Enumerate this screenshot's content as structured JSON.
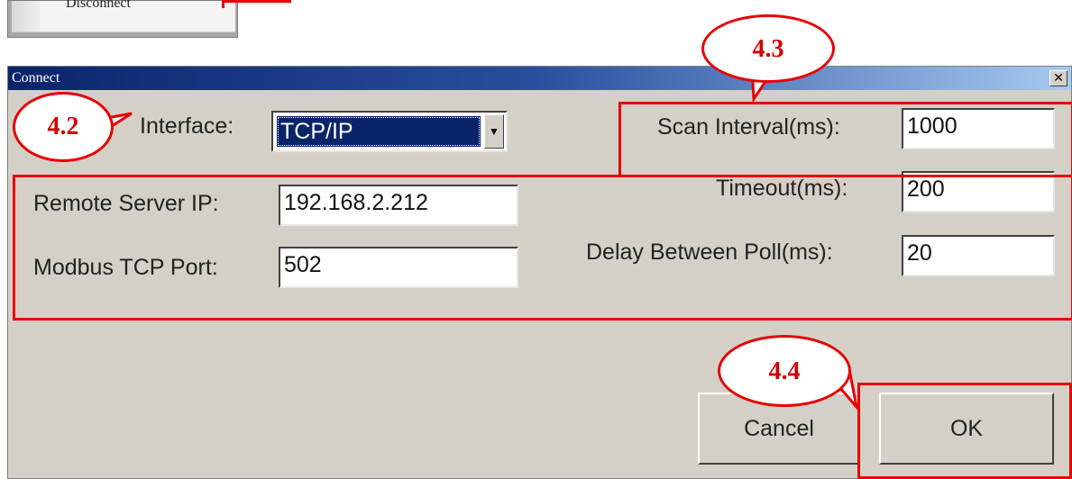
{
  "menu_fragment": {
    "label": "Disconnect"
  },
  "dialog": {
    "title": "Connect",
    "close_symbol": "✕",
    "interface": {
      "label": "Interface:",
      "value": "TCP/IP"
    },
    "remote_ip": {
      "label": "Remote Server IP:",
      "value": "192.168.2.212"
    },
    "tcp_port": {
      "label": "Modbus TCP Port:",
      "value": "502"
    },
    "scan_interval": {
      "label": "Scan Interval(ms):",
      "value": "1000"
    },
    "timeout": {
      "label": "Timeout(ms):",
      "value": "200"
    },
    "delay_poll": {
      "label": "Delay Between Poll(ms):",
      "value": "20"
    },
    "cancel_label": "Cancel",
    "ok_label": "OK"
  },
  "annotations": {
    "c42": "4.2",
    "c43": "4.3",
    "c44": "4.4",
    "color": "#e80000"
  }
}
